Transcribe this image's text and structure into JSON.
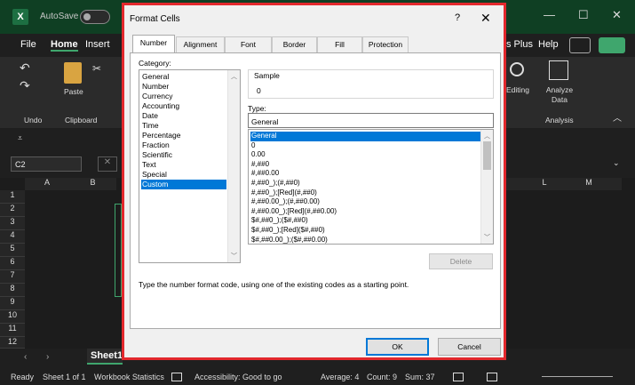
{
  "excel": {
    "autosave_label": "AutoSave",
    "autosave_state": "Off",
    "ribbon_tabs": [
      "File",
      "Home",
      "Insert"
    ],
    "ribbon_tab_partial": "s Plus",
    "help_tab": "Help",
    "ribbon_groups": {
      "undo": "Undo",
      "clipboard": "Clipboard",
      "paste": "Paste",
      "editing": "Editing",
      "analyze_data": "Analyze Data",
      "analysis": "Analysis"
    },
    "name_box": "C2",
    "columns_left": [
      "A",
      "B"
    ],
    "columns_right": [
      "L",
      "M"
    ],
    "rows": [
      "1",
      "2",
      "3",
      "4",
      "5",
      "6",
      "7",
      "8",
      "9",
      "10",
      "11",
      "12"
    ],
    "sheet_tab": "Sheet1",
    "status": {
      "ready": "Ready",
      "sheet_info": "Sheet 1 of 1",
      "workbook_stats": "Workbook Statistics",
      "accessibility": "Accessibility: Good to go",
      "average": "Average: 4",
      "count": "Count: 9",
      "sum": "Sum: 37"
    }
  },
  "dialog": {
    "title": "Format Cells",
    "help": "?",
    "close": "✕",
    "tabs": [
      "Number",
      "Alignment",
      "Font",
      "Border",
      "Fill",
      "Protection"
    ],
    "active_tab": "Number",
    "category_label": "Category:",
    "categories": [
      "General",
      "Number",
      "Currency",
      "Accounting",
      "Date",
      "Time",
      "Percentage",
      "Fraction",
      "Scientific",
      "Text",
      "Special",
      "Custom"
    ],
    "selected_category": "Custom",
    "sample_label": "Sample",
    "sample_value": "0",
    "type_label": "Type:",
    "type_value": "General",
    "formats": [
      "General",
      "0",
      "0.00",
      "#,##0",
      "#,##0.00",
      "#,##0_);(#,##0)",
      "#,##0_);[Red](#,##0)",
      "#,##0.00_);(#,##0.00)",
      "#,##0.00_);[Red](#,##0.00)",
      "$#,##0_);($#,##0)",
      "$#,##0_);[Red]($#,##0)",
      "$#,##0.00_);($#,##0.00)"
    ],
    "selected_format": "General",
    "delete_label": "Delete",
    "description": "Type the number format code, using one of the existing codes as a starting point.",
    "ok_label": "OK",
    "cancel_label": "Cancel"
  }
}
